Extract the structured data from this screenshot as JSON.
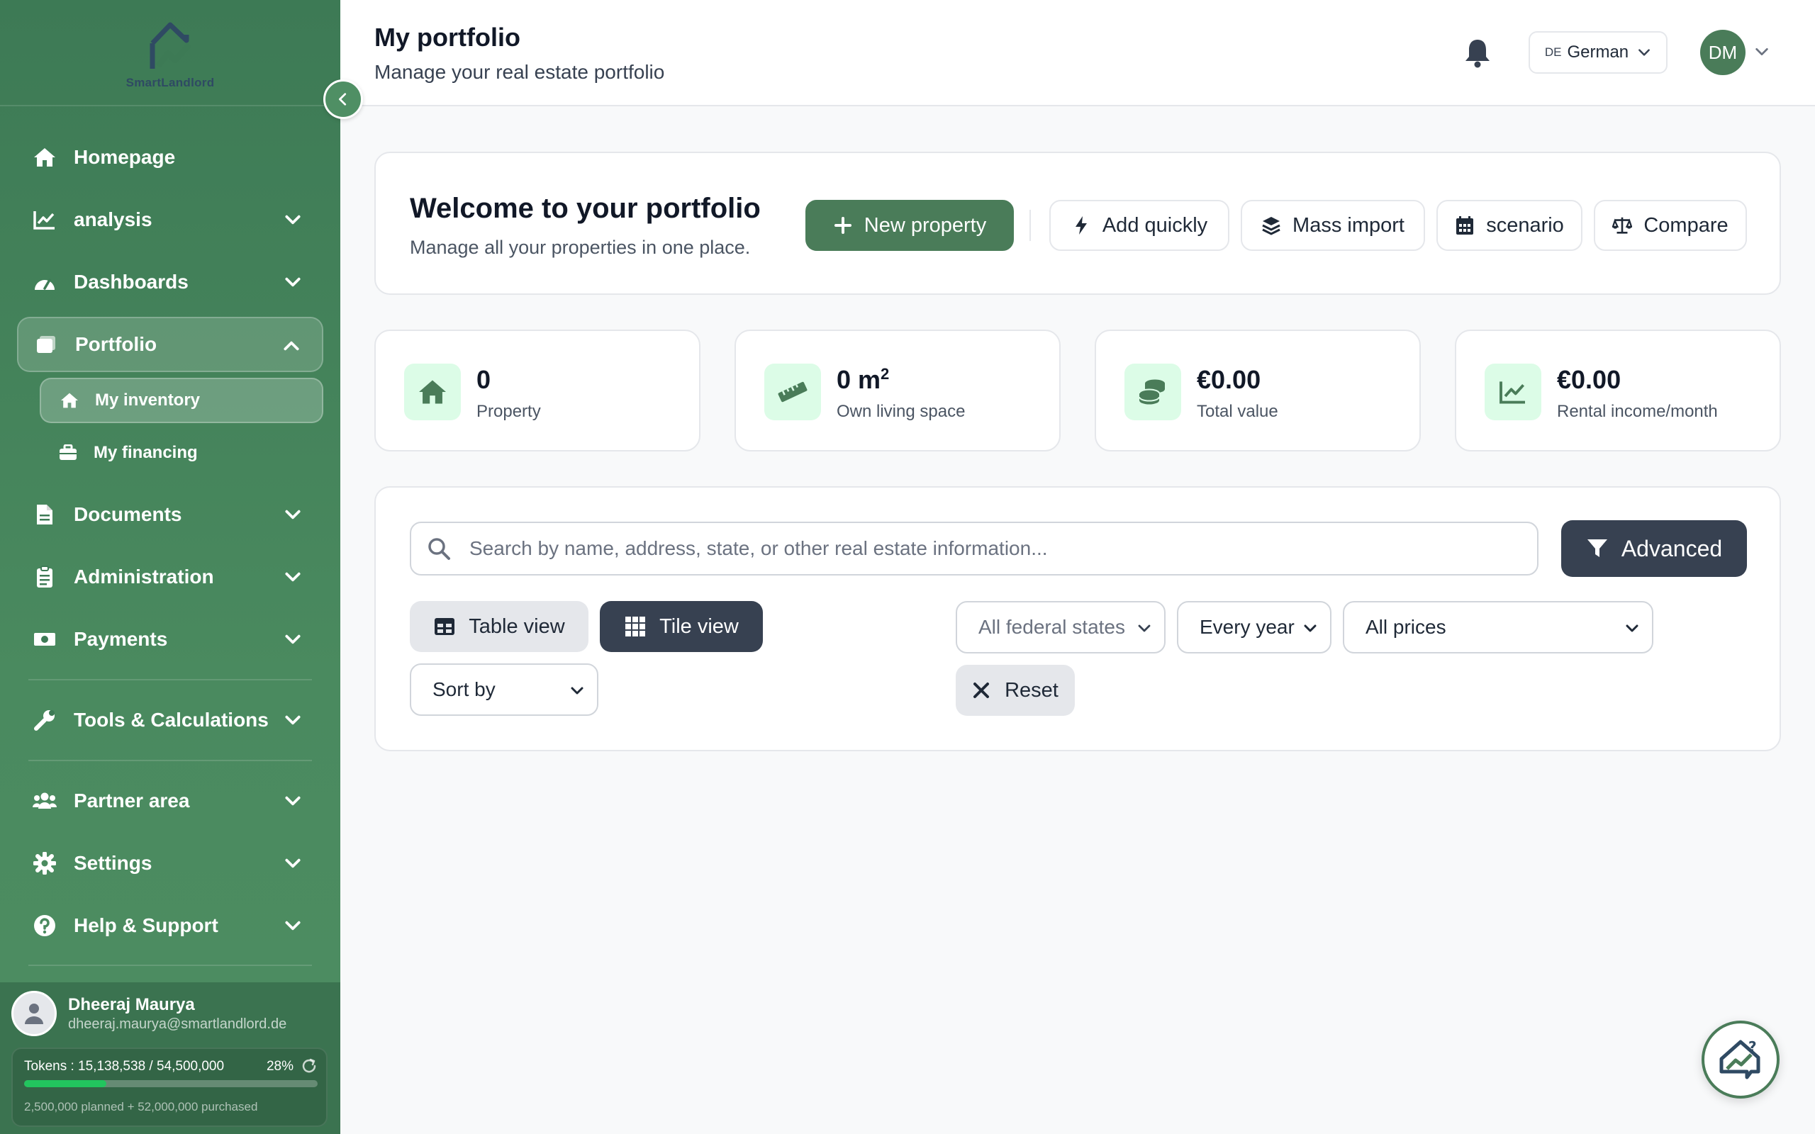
{
  "sidebar": {
    "logo_text": "SmartLandlord",
    "items": [
      {
        "label": "Homepage",
        "icon": "home-icon"
      },
      {
        "label": "analysis",
        "icon": "chart-line-icon"
      },
      {
        "label": "Dashboards",
        "icon": "gauge-icon"
      },
      {
        "label": "Portfolio",
        "icon": "folder-icon"
      },
      {
        "label": "Documents",
        "icon": "document-icon"
      },
      {
        "label": "Administration",
        "icon": "clipboard-icon"
      },
      {
        "label": "Payments",
        "icon": "money-icon"
      },
      {
        "label": "Tools & Calculations",
        "icon": "wrench-icon"
      },
      {
        "label": "Partner area",
        "icon": "users-icon"
      },
      {
        "label": "Settings",
        "icon": "gear-icon"
      },
      {
        "label": "Help & Support",
        "icon": "question-icon"
      }
    ],
    "portfolio_sub": [
      {
        "label": "My inventory",
        "icon": "home-icon"
      },
      {
        "label": "My financing",
        "icon": "briefcase-icon"
      }
    ],
    "user": {
      "name": "Dheeraj Maurya",
      "email": "dheeraj.maurya@smartlandlord.de"
    },
    "tokens": {
      "label": "Tokens : 15,138,538 / 54,500,000",
      "percent_label": "28%",
      "fraction": 0.28,
      "detail": "2,500,000 planned + 52,000,000 purchased"
    }
  },
  "header": {
    "title": "My portfolio",
    "subtitle": "Manage your real estate portfolio",
    "language_code": "DE",
    "language": "German",
    "avatar_initials": "DM"
  },
  "welcome": {
    "title": "Welcome to your portfolio",
    "subtitle": "Manage all your properties in one place.",
    "new_property": "New property",
    "add_quickly": "Add quickly",
    "mass_import": "Mass import",
    "scenario": "scenario",
    "compare": "Compare"
  },
  "stats": [
    {
      "value": "0",
      "label": "Property",
      "icon": "house-icon"
    },
    {
      "value": "0 m",
      "sup": "2",
      "label": "Own living space",
      "icon": "ruler-icon"
    },
    {
      "value": "€0.00",
      "label": "Total value",
      "icon": "coins-icon"
    },
    {
      "value": "€0.00",
      "label": "Rental income/month",
      "icon": "chart-line-icon"
    }
  ],
  "filters": {
    "search_placeholder": "Search by name, address, state, or other real estate information...",
    "advanced": "Advanced",
    "table_view": "Table view",
    "tile_view": "Tile view",
    "federal_states": "All federal states",
    "year": "Every year",
    "prices": "All prices",
    "sort_by": "Sort by",
    "reset": "Reset"
  },
  "colors": {
    "brand_green": "#4a7c59",
    "dark_button": "#374151",
    "icon_bg": "#dcfce7"
  }
}
